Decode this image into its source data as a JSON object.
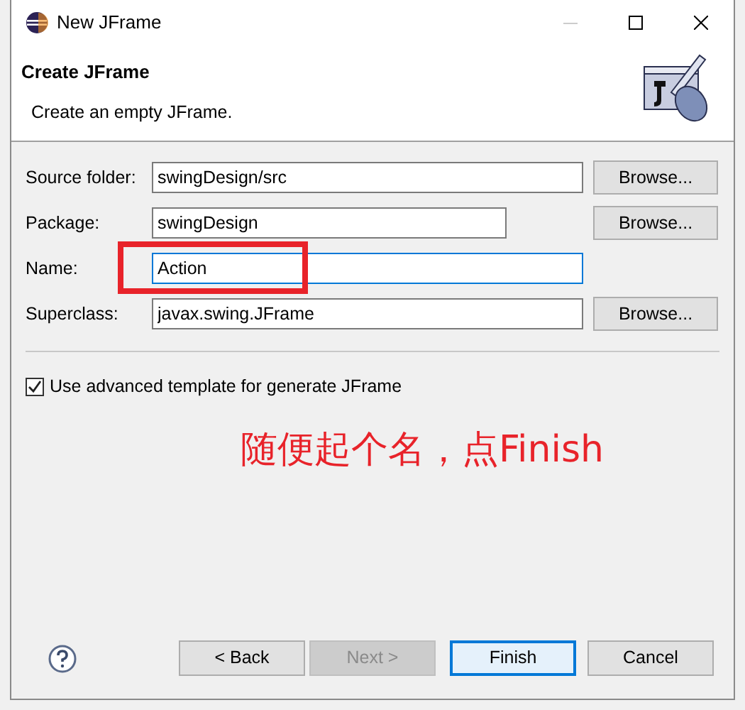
{
  "window": {
    "title": "New JFrame"
  },
  "header": {
    "title": "Create JFrame",
    "description": "Create an empty JFrame."
  },
  "fields": [
    {
      "label": "Source folder:",
      "value": "swingDesign/src",
      "focused": false,
      "button": "Browse..."
    },
    {
      "label": "Package:",
      "value": "swingDesign",
      "focused": false,
      "button": "Browse..."
    },
    {
      "label": "Name:",
      "value": "Action",
      "focused": true,
      "highlighted": true
    },
    {
      "label": "Superclass:",
      "value": "javax.swing.JFrame",
      "focused": false,
      "button": "Browse..."
    }
  ],
  "option": {
    "label": "Use advanced template for generate JFrame",
    "checked": true
  },
  "annotation": {
    "text": "随便起个名，点Finish"
  },
  "buttons": [
    {
      "label": "< Back",
      "disabled": false,
      "default": false
    },
    {
      "label": "Next >",
      "disabled": true,
      "default": false
    },
    {
      "label": "Finish",
      "disabled": false,
      "default": true
    },
    {
      "label": "Cancel",
      "disabled": false,
      "default": false
    }
  ]
}
